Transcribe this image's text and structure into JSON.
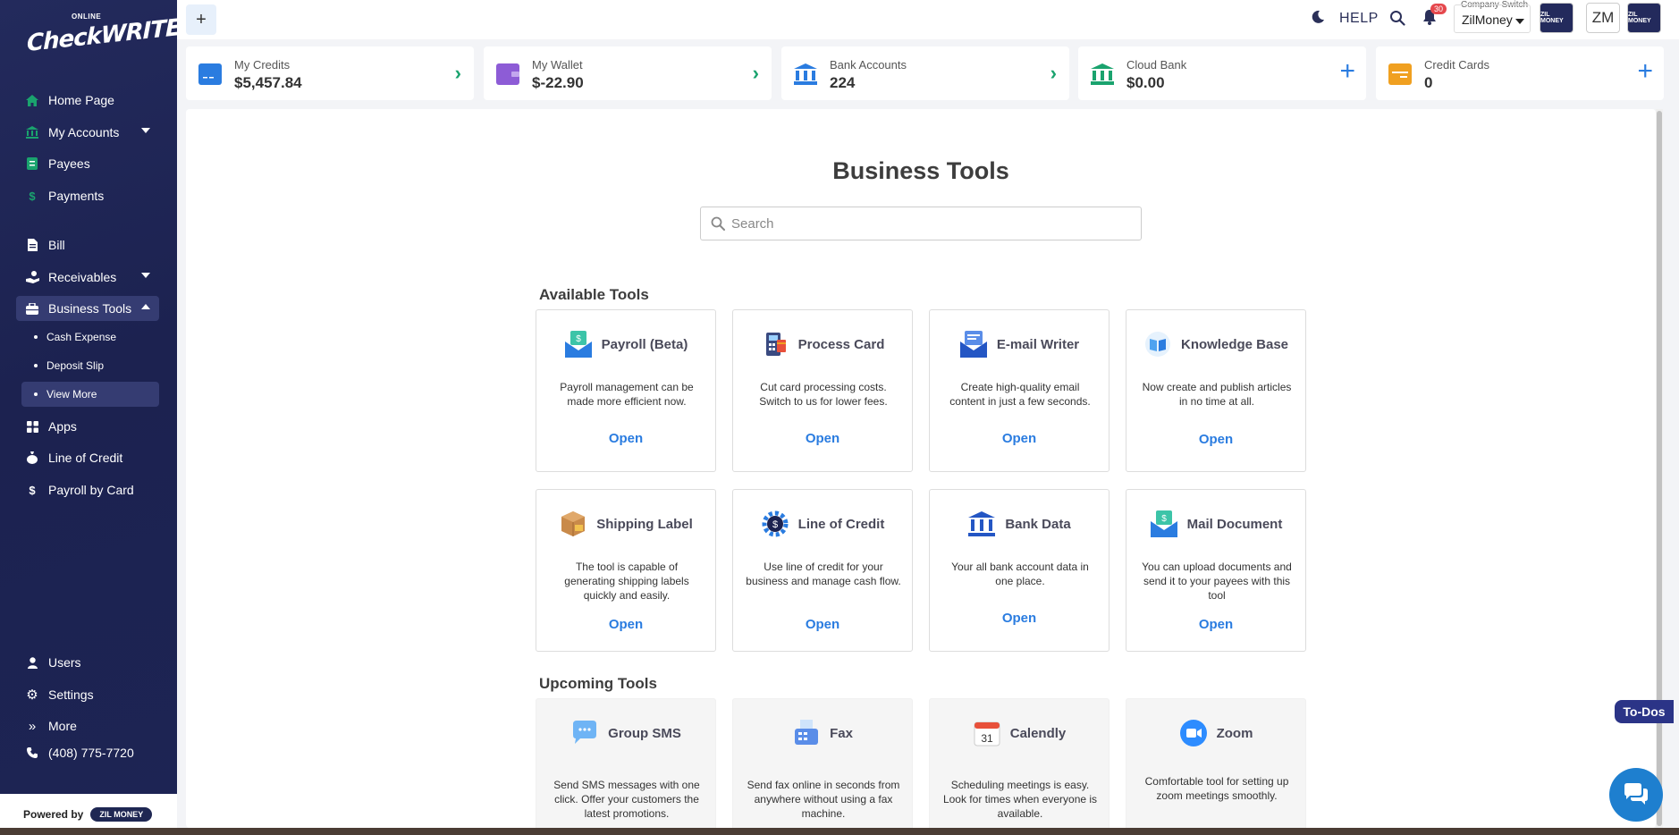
{
  "sidebar": {
    "logo_small": "ONLINE",
    "logo_main": "CheckWRITER",
    "items": [
      {
        "label": "Home Page",
        "icon": "home-icon"
      },
      {
        "label": "My Accounts",
        "icon": "bank-icon"
      },
      {
        "label": "Payees",
        "icon": "payee-icon"
      },
      {
        "label": "Payments",
        "icon": "dollar-icon"
      },
      {
        "label": "Bill",
        "icon": "bill-icon"
      },
      {
        "label": "Receivables",
        "icon": "hand-coin-icon"
      },
      {
        "label": "Business Tools",
        "icon": "toolbox-icon"
      },
      {
        "label": "Apps",
        "icon": "apps-grid-icon"
      },
      {
        "label": "Line of Credit",
        "icon": "money-bag-icon"
      },
      {
        "label": "Payroll by Card",
        "icon": "dollar-icon"
      },
      {
        "label": "Users",
        "icon": "user-icon"
      },
      {
        "label": "Settings",
        "icon": "gear-icon"
      },
      {
        "label": "More",
        "icon": "double-chevron-icon"
      },
      {
        "label": "(408) 775-7720",
        "icon": "phone-icon"
      }
    ],
    "sub_items": [
      "Cash Expense",
      "Deposit Slip",
      "View More"
    ],
    "powered_by": "Powered by",
    "powered_badge": "ZIL MONEY"
  },
  "topbar": {
    "add_label": "+",
    "help": "HELP",
    "notification_count": "30",
    "company_switch_label": "Company Switch",
    "company_name": "ZilMoney",
    "user_initials": "ZM",
    "logo_text": "ZIL MONEY"
  },
  "stats": [
    {
      "label": "My Credits",
      "value": "$5,457.84",
      "action": "arrow",
      "color": "#2a7ce0"
    },
    {
      "label": "My Wallet",
      "value": "$-22.90",
      "action": "arrow",
      "color": "#8d5cd6"
    },
    {
      "label": "Bank Accounts",
      "value": "224",
      "action": "arrow",
      "color": "#2a7ce0"
    },
    {
      "label": "Cloud Bank",
      "value": "$0.00",
      "action": "plus",
      "color": "#1aa36e"
    },
    {
      "label": "Credit Cards",
      "value": "0",
      "action": "plus",
      "color": "#f0a020"
    }
  ],
  "main": {
    "title": "Business Tools",
    "search_placeholder": "Search",
    "available_title": "Available Tools",
    "upcoming_title": "Upcoming Tools",
    "open_label": "Open",
    "available": [
      {
        "name": "Payroll (Beta)",
        "desc": "Payroll management can be made more efficient now.",
        "icon": "payroll-envelope-icon"
      },
      {
        "name": "Process Card",
        "desc": "Cut card processing costs. Switch to us for lower fees.",
        "icon": "card-terminal-icon"
      },
      {
        "name": "E-mail Writer",
        "desc": "Create high-quality email content in just a few seconds.",
        "icon": "email-writer-icon"
      },
      {
        "name": "Knowledge Base",
        "desc": "Now create and publish articles in no time at all.",
        "icon": "book-icon"
      },
      {
        "name": "Shipping Label",
        "desc": "The tool is capable of generating shipping labels quickly and easily.",
        "icon": "package-label-icon"
      },
      {
        "name": "Line of Credit",
        "desc": "Use line of credit for your business and manage cash flow.",
        "icon": "credit-gear-icon"
      },
      {
        "name": "Bank Data",
        "desc": "Your all bank account data in one place.",
        "icon": "bank-building-icon"
      },
      {
        "name": "Mail Document",
        "desc": "You can upload documents and send it to your payees with this tool",
        "icon": "mail-document-icon"
      }
    ],
    "upcoming": [
      {
        "name": "Group SMS",
        "desc": "Send SMS messages with one click. Offer your customers the latest promotions.",
        "icon": "chat-bubble-icon"
      },
      {
        "name": "Fax",
        "desc": "Send fax online in seconds from anywhere without using a fax machine.",
        "icon": "fax-icon"
      },
      {
        "name": "Calendly",
        "desc": "Scheduling meetings is easy. Look for times when everyone is available.",
        "icon": "calendar-icon",
        "calendar_day": "31"
      },
      {
        "name": "Zoom",
        "desc": "Comfortable tool for setting up zoom meetings smoothly.",
        "icon": "video-camera-icon"
      }
    ]
  },
  "widgets": {
    "todos": "To-Dos"
  }
}
